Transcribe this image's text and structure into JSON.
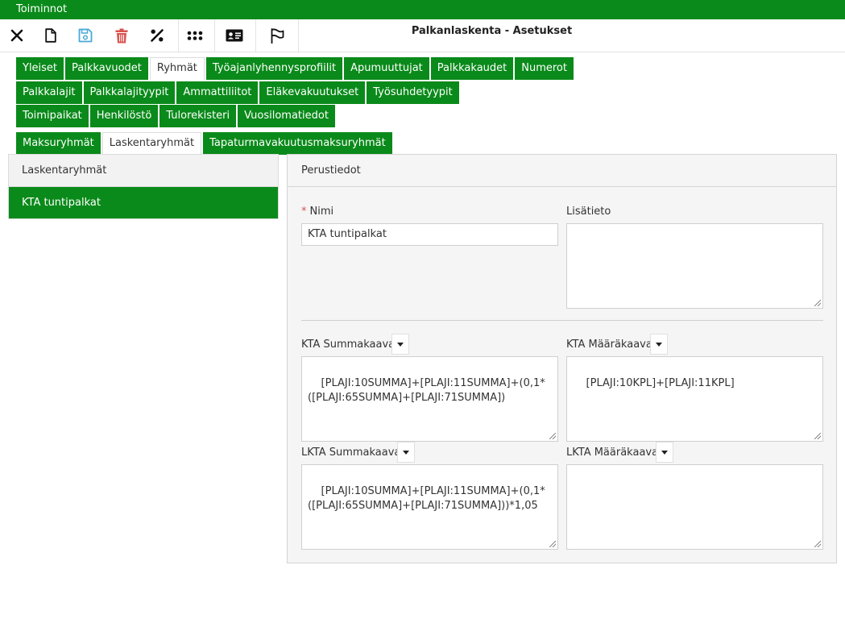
{
  "menubar": {
    "label": "Toiminnot"
  },
  "toolbar": {
    "title": "Palkanlaskenta - Asetukset",
    "buttons": [
      {
        "name": "close-icon",
        "color": "#111111"
      },
      {
        "name": "new-document-icon",
        "color": "#111111"
      },
      {
        "name": "save-icon",
        "color": "#4aa8d8"
      },
      {
        "name": "delete-icon",
        "color": "#d9534f"
      },
      {
        "name": "percent-icon",
        "color": "#111111"
      },
      {
        "name": "apps-grid-icon",
        "color": "#111111"
      },
      {
        "name": "id-card-icon",
        "color": "#111111"
      },
      {
        "name": "flag-icon",
        "color": "#111111"
      }
    ]
  },
  "tabs": {
    "row1": [
      "Yleiset",
      "Palkkavuodet",
      "Ryhmät",
      "Työajanlyhennysprofiilit",
      "Apumuuttujat",
      "Palkkakaudet",
      "Numerot"
    ],
    "row2": [
      "Palkkalajit",
      "Palkkalajityypit",
      "Ammattiliitot",
      "Eläkevakuutukset",
      "Työsuhdetyypit"
    ],
    "row3": [
      "Toimipaikat",
      "Henkilöstö",
      "Tulorekisteri",
      "Vuosilomatiedot"
    ],
    "row4": [
      "Maksuryhmät",
      "Laskentaryhmät",
      "Tapaturmavakuutusmaksuryhmät"
    ],
    "active_main": "Ryhmät",
    "active_sub": "Laskentaryhmät"
  },
  "left": {
    "header": "Laskentaryhmät",
    "items": [
      "KTA tuntipalkat"
    ]
  },
  "form": {
    "section_title": "Perustiedot",
    "nimi_label": "Nimi",
    "nimi_value": "KTA tuntipalkat",
    "lisatieto_label": "Lisätieto",
    "lisatieto_value": "",
    "kta_summa_label": "KTA Summakaava",
    "kta_summa_value": "[PLAJI:10SUMMA]+[PLAJI:11SUMMA]+(0,1*([PLAJI:65SUMMA]+[PLAJI:71SUMMA])",
    "kta_maara_label": "KTA Määräkaava",
    "kta_maara_value": "[PLAJI:10KPL]+[PLAJI:11KPL]",
    "lkta_summa_label": "LKTA Summakaava",
    "lkta_summa_value": "[PLAJI:10SUMMA]+[PLAJI:11SUMMA]+(0,1*([PLAJI:65SUMMA]+[PLAJI:71SUMMA]))*1,05",
    "lkta_maara_label": "LKTA Määräkaava",
    "lkta_maara_value": ""
  },
  "colors": {
    "accent": "#0a8a1a",
    "danger": "#d9534f",
    "info": "#4aa8d8"
  }
}
